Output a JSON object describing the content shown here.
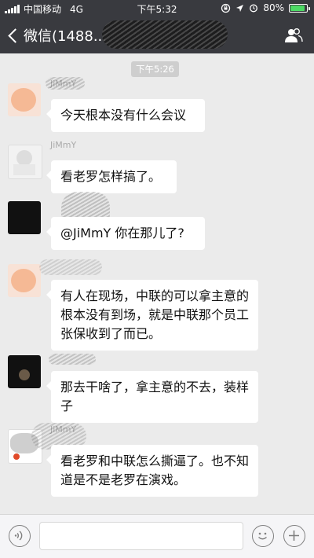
{
  "status_bar": {
    "carrier": "中国移动",
    "network": "4G",
    "time": "下午5:32",
    "battery": "80%"
  },
  "nav": {
    "back_label": "微信(1488..."
  },
  "chat": {
    "timestamp": "下午5:26",
    "messages": [
      {
        "sender": "JiMmY",
        "text": "今天根本没有什么会议"
      },
      {
        "sender": "JiMmY",
        "text": "看老罗怎样搞了。"
      },
      {
        "sender": "",
        "text": "@JiMmY 你在那儿了?"
      },
      {
        "sender": "",
        "text": "有人在现场，中联的可以拿主意的根本没有到场，就是中联那个员工张保收到了而已。"
      },
      {
        "sender": "",
        "text": "那去干啥了，拿主意的不去，装样子"
      },
      {
        "sender": "JiMmY",
        "text": "看老罗和中联怎么撕逼了。也不知道是不是老罗在演戏。"
      }
    ]
  },
  "input_bar": {
    "placeholder": ""
  },
  "colors": {
    "nav_bg": "#393a3f",
    "chat_bg": "#ebebeb",
    "bubble_bg": "#ffffff",
    "battery_fill": "#4cd964"
  },
  "icons": [
    "signal-icon",
    "lock-rotation-icon",
    "location-icon",
    "alarm-icon",
    "battery-icon",
    "back-chevron-icon",
    "contacts-icon",
    "voice-icon",
    "emoji-icon",
    "plus-icon"
  ]
}
